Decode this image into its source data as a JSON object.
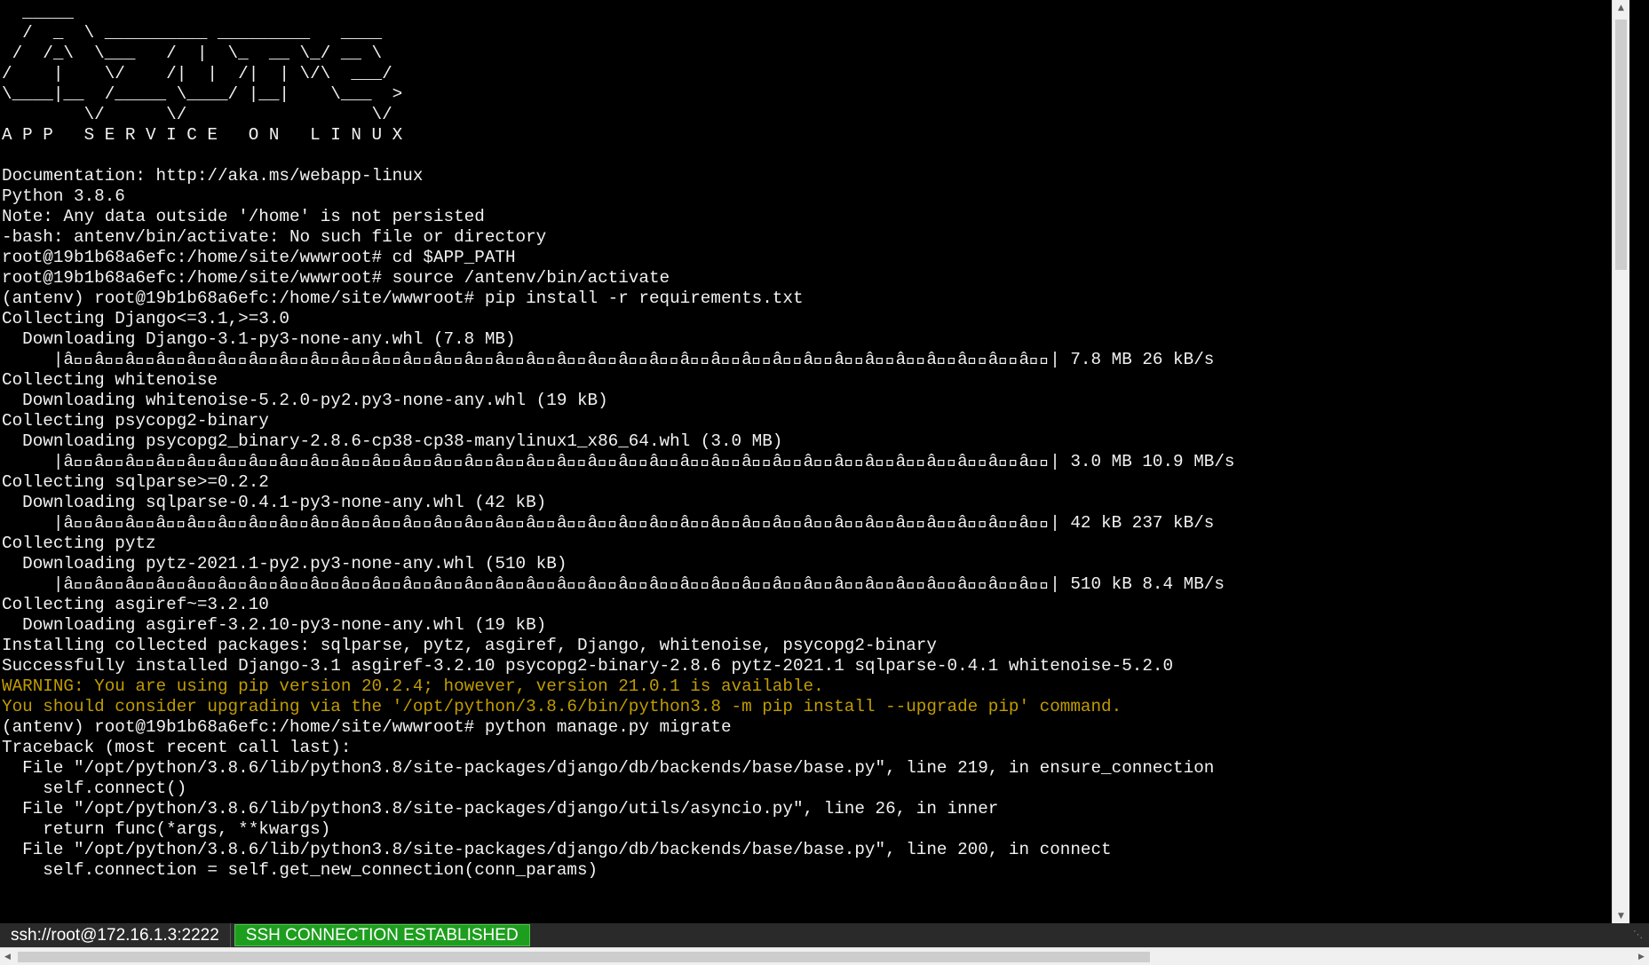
{
  "terminal": {
    "lines": [
      {
        "text": "  _____",
        "style": "normal"
      },
      {
        "text": "  /  _  \\ __________ _________   ____",
        "style": "normal"
      },
      {
        "text": " /  /_\\  \\___   /  |  \\_  __ \\_/ __ \\",
        "style": "normal"
      },
      {
        "text": "/    |    \\/    /|  |  /|  | \\/\\  ___/",
        "style": "normal"
      },
      {
        "text": "\\____|__  /_____ \\____/ |__|    \\___  >",
        "style": "normal"
      },
      {
        "text": "        \\/      \\/                  \\/",
        "style": "normal"
      },
      {
        "text": "A P P   S E R V I C E   O N   L I N U X",
        "style": "normal"
      },
      {
        "text": "",
        "style": "normal"
      },
      {
        "text": "Documentation: http://aka.ms/webapp-linux",
        "style": "normal"
      },
      {
        "text": "Python 3.8.6",
        "style": "normal"
      },
      {
        "text": "Note: Any data outside '/home' is not persisted",
        "style": "normal"
      },
      {
        "text": "-bash: antenv/bin/activate: No such file or directory",
        "style": "normal"
      },
      {
        "text": "root@19b1b68a6efc:/home/site/wwwroot# cd $APP_PATH",
        "style": "normal"
      },
      {
        "text": "root@19b1b68a6efc:/home/site/wwwroot# source /antenv/bin/activate",
        "style": "normal"
      },
      {
        "text": "(antenv) root@19b1b68a6efc:/home/site/wwwroot# pip install -r requirements.txt",
        "style": "normal"
      },
      {
        "text": "Collecting Django<=3.1,>=3.0",
        "style": "normal"
      },
      {
        "text": "  Downloading Django-3.1-py3-none-any.whl (7.8 MB)",
        "style": "normal"
      },
      {
        "text": "     |â\u0000\u0000â\u0000\u0000â\u0000\u0000â\u0000\u0000â\u0000\u0000â\u0000\u0000â\u0000\u0000â\u0000\u0000â\u0000\u0000â\u0000\u0000â\u0000\u0000â\u0000\u0000â\u0000\u0000â\u0000\u0000â\u0000\u0000â\u0000\u0000â\u0000\u0000â\u0000\u0000â\u0000\u0000â\u0000\u0000â\u0000\u0000â\u0000\u0000â\u0000\u0000â\u0000\u0000â\u0000\u0000â\u0000\u0000â\u0000\u0000â\u0000\u0000â\u0000\u0000â\u0000\u0000â\u0000\u0000â\u0000\u0000| 7.8 MB 26 kB/s",
        "style": "normal"
      },
      {
        "text": "Collecting whitenoise",
        "style": "normal"
      },
      {
        "text": "  Downloading whitenoise-5.2.0-py2.py3-none-any.whl (19 kB)",
        "style": "normal"
      },
      {
        "text": "Collecting psycopg2-binary",
        "style": "normal"
      },
      {
        "text": "  Downloading psycopg2_binary-2.8.6-cp38-cp38-manylinux1_x86_64.whl (3.0 MB)",
        "style": "normal"
      },
      {
        "text": "     |â\u0000\u0000â\u0000\u0000â\u0000\u0000â\u0000\u0000â\u0000\u0000â\u0000\u0000â\u0000\u0000â\u0000\u0000â\u0000\u0000â\u0000\u0000â\u0000\u0000â\u0000\u0000â\u0000\u0000â\u0000\u0000â\u0000\u0000â\u0000\u0000â\u0000\u0000â\u0000\u0000â\u0000\u0000â\u0000\u0000â\u0000\u0000â\u0000\u0000â\u0000\u0000â\u0000\u0000â\u0000\u0000â\u0000\u0000â\u0000\u0000â\u0000\u0000â\u0000\u0000â\u0000\u0000â\u0000\u0000â\u0000\u0000| 3.0 MB 10.9 MB/s",
        "style": "normal"
      },
      {
        "text": "Collecting sqlparse>=0.2.2",
        "style": "normal"
      },
      {
        "text": "  Downloading sqlparse-0.4.1-py3-none-any.whl (42 kB)",
        "style": "normal"
      },
      {
        "text": "     |â\u0000\u0000â\u0000\u0000â\u0000\u0000â\u0000\u0000â\u0000\u0000â\u0000\u0000â\u0000\u0000â\u0000\u0000â\u0000\u0000â\u0000\u0000â\u0000\u0000â\u0000\u0000â\u0000\u0000â\u0000\u0000â\u0000\u0000â\u0000\u0000â\u0000\u0000â\u0000\u0000â\u0000\u0000â\u0000\u0000â\u0000\u0000â\u0000\u0000â\u0000\u0000â\u0000\u0000â\u0000\u0000â\u0000\u0000â\u0000\u0000â\u0000\u0000â\u0000\u0000â\u0000\u0000â\u0000\u0000â\u0000\u0000| 42 kB 237 kB/s",
        "style": "normal"
      },
      {
        "text": "Collecting pytz",
        "style": "normal"
      },
      {
        "text": "  Downloading pytz-2021.1-py2.py3-none-any.whl (510 kB)",
        "style": "normal"
      },
      {
        "text": "     |â\u0000\u0000â\u0000\u0000â\u0000\u0000â\u0000\u0000â\u0000\u0000â\u0000\u0000â\u0000\u0000â\u0000\u0000â\u0000\u0000â\u0000\u0000â\u0000\u0000â\u0000\u0000â\u0000\u0000â\u0000\u0000â\u0000\u0000â\u0000\u0000â\u0000\u0000â\u0000\u0000â\u0000\u0000â\u0000\u0000â\u0000\u0000â\u0000\u0000â\u0000\u0000â\u0000\u0000â\u0000\u0000â\u0000\u0000â\u0000\u0000â\u0000\u0000â\u0000\u0000â\u0000\u0000â\u0000\u0000â\u0000\u0000| 510 kB 8.4 MB/s",
        "style": "normal"
      },
      {
        "text": "Collecting asgiref~=3.2.10",
        "style": "normal"
      },
      {
        "text": "  Downloading asgiref-3.2.10-py3-none-any.whl (19 kB)",
        "style": "normal"
      },
      {
        "text": "Installing collected packages: sqlparse, pytz, asgiref, Django, whitenoise, psycopg2-binary",
        "style": "normal"
      },
      {
        "text": "Successfully installed Django-3.1 asgiref-3.2.10 psycopg2-binary-2.8.6 pytz-2021.1 sqlparse-0.4.1 whitenoise-5.2.0",
        "style": "normal"
      },
      {
        "text": "WARNING: You are using pip version 20.2.4; however, version 21.0.1 is available.",
        "style": "warn"
      },
      {
        "text": "You should consider upgrading via the '/opt/python/3.8.6/bin/python3.8 -m pip install --upgrade pip' command.",
        "style": "warn"
      },
      {
        "text": "(antenv) root@19b1b68a6efc:/home/site/wwwroot# python manage.py migrate",
        "style": "normal"
      },
      {
        "text": "Traceback (most recent call last):",
        "style": "normal"
      },
      {
        "text": "  File \"/opt/python/3.8.6/lib/python3.8/site-packages/django/db/backends/base/base.py\", line 219, in ensure_connection",
        "style": "normal"
      },
      {
        "text": "    self.connect()",
        "style": "normal"
      },
      {
        "text": "  File \"/opt/python/3.8.6/lib/python3.8/site-packages/django/utils/asyncio.py\", line 26, in inner",
        "style": "normal"
      },
      {
        "text": "    return func(*args, **kwargs)",
        "style": "normal"
      },
      {
        "text": "  File \"/opt/python/3.8.6/lib/python3.8/site-packages/django/db/backends/base/base.py\", line 200, in connect",
        "style": "normal"
      },
      {
        "text": "    self.connection = self.get_new_connection(conn_params)",
        "style": "normal"
      }
    ]
  },
  "status_bar": {
    "address": "ssh://root@172.16.1.3:2222",
    "connection_status": "SSH CONNECTION ESTABLISHED"
  },
  "colors": {
    "background": "#000000",
    "foreground": "#f2f2f2",
    "warning": "#c19c00",
    "status_ok": "#1e9e1e"
  },
  "icons": {
    "scroll_up": "triangle-up-icon",
    "scroll_down": "triangle-down-icon",
    "scroll_left": "triangle-left-icon",
    "scroll_right": "triangle-right-icon",
    "resize_grip": "resize-grip-icon"
  }
}
